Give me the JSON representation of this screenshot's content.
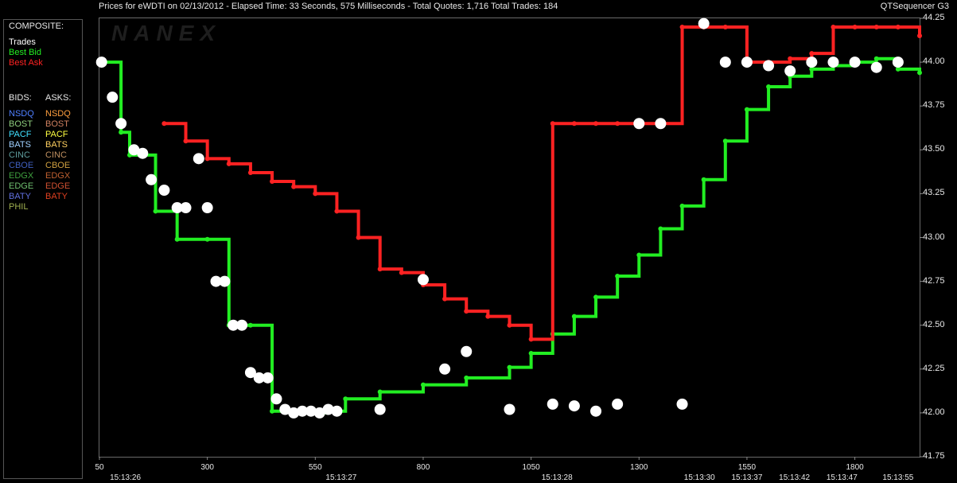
{
  "header": {
    "title": "Prices for  eWDTI  on  02/13/2012  -  Elapsed Time: 33 Seconds, 575 Milliseconds  -  Total Quotes: 1,716  Total Trades: 184",
    "app": "QTSequencer G3",
    "watermark": "NANEX"
  },
  "legend": {
    "composite_label": "COMPOSITE:",
    "composite": [
      {
        "label": "Trades",
        "color": "#ffffff"
      },
      {
        "label": "Best Bid",
        "color": "#22ee22"
      },
      {
        "label": "Best Ask",
        "color": "#ff2222"
      }
    ],
    "bids_label": "BIDS:",
    "asks_label": "ASKS:",
    "bids": [
      {
        "label": "NSDQ",
        "color": "#4f7fff"
      },
      {
        "label": "BOST",
        "color": "#8fcf7f"
      },
      {
        "label": "PACF",
        "color": "#40e0ff"
      },
      {
        "label": "BATS",
        "color": "#9fd0ff"
      },
      {
        "label": "CINC",
        "color": "#5f9f9f"
      },
      {
        "label": "CBOE",
        "color": "#3f5fbf"
      },
      {
        "label": "EDGX",
        "color": "#3fa03f"
      },
      {
        "label": "EDGE",
        "color": "#6fbf6f"
      },
      {
        "label": "BATY",
        "color": "#6070e0"
      },
      {
        "label": "PHIL",
        "color": "#9faf4f"
      }
    ],
    "asks": [
      {
        "label": "NSDQ",
        "color": "#ff9f3f"
      },
      {
        "label": "BOST",
        "color": "#d08060"
      },
      {
        "label": "PACF",
        "color": "#ffff40"
      },
      {
        "label": "BATS",
        "color": "#ffd060"
      },
      {
        "label": "CINC",
        "color": "#c09060"
      },
      {
        "label": "CBOE",
        "color": "#d0a040"
      },
      {
        "label": "EDGX",
        "color": "#c06030"
      },
      {
        "label": "EDGE",
        "color": "#d05030"
      },
      {
        "label": "BATY",
        "color": "#e04020"
      }
    ]
  },
  "chart_data": {
    "type": "line",
    "ylim": [
      41.75,
      44.25
    ],
    "xlim": [
      50,
      1950
    ],
    "y_ticks": [
      "44.25",
      "44.00",
      "43.75",
      "43.50",
      "43.25",
      "43.00",
      "42.75",
      "42.50",
      "42.25",
      "42.00",
      "41.75"
    ],
    "x_ticks": [
      {
        "x": 50,
        "label": "50"
      },
      {
        "x": 300,
        "label": "300"
      },
      {
        "x": 550,
        "label": "550"
      },
      {
        "x": 800,
        "label": "800"
      },
      {
        "x": 1050,
        "label": "1050"
      },
      {
        "x": 1300,
        "label": "1300"
      },
      {
        "x": 1550,
        "label": "1550"
      },
      {
        "x": 1800,
        "label": "1800"
      }
    ],
    "time_ticks": [
      {
        "x": 110,
        "label": "15:13:26"
      },
      {
        "x": 610,
        "label": "15:13:27"
      },
      {
        "x": 1110,
        "label": "15:13:28"
      },
      {
        "x": 1440,
        "label": "15:13:30"
      },
      {
        "x": 1550,
        "label": "15:13:37"
      },
      {
        "x": 1660,
        "label": "15:13:42"
      },
      {
        "x": 1770,
        "label": "15:13:47"
      },
      {
        "x": 1900,
        "label": "15:13:55"
      }
    ],
    "series": [
      {
        "name": "Best Bid",
        "color": "#22ee22",
        "x": [
          50,
          100,
          120,
          180,
          230,
          300,
          350,
          400,
          450,
          500,
          550,
          580,
          620,
          700,
          800,
          900,
          1000,
          1050,
          1100,
          1150,
          1200,
          1250,
          1300,
          1350,
          1400,
          1450,
          1500,
          1550,
          1600,
          1650,
          1700,
          1750,
          1800,
          1850,
          1900,
          1950
        ],
        "values": [
          44.0,
          43.6,
          43.47,
          43.15,
          42.99,
          42.99,
          42.5,
          42.5,
          42.01,
          42.01,
          42.0,
          42.01,
          42.08,
          42.12,
          42.16,
          42.2,
          42.26,
          42.34,
          42.45,
          42.55,
          42.66,
          42.78,
          42.9,
          43.05,
          43.18,
          43.33,
          43.55,
          43.73,
          43.86,
          43.92,
          43.96,
          43.98,
          44.0,
          44.02,
          43.96,
          43.94
        ]
      },
      {
        "name": "Best Ask",
        "color": "#ff2222",
        "x": [
          200,
          250,
          300,
          350,
          400,
          450,
          500,
          550,
          600,
          650,
          700,
          750,
          800,
          850,
          900,
          950,
          1000,
          1050,
          1100,
          1150,
          1200,
          1250,
          1300,
          1350,
          1400,
          1450,
          1500,
          1550,
          1600,
          1650,
          1700,
          1750,
          1800,
          1850,
          1900,
          1950
        ],
        "values": [
          43.65,
          43.55,
          43.45,
          43.42,
          43.37,
          43.32,
          43.29,
          43.25,
          43.15,
          43.0,
          42.82,
          42.8,
          42.73,
          42.65,
          42.58,
          42.55,
          42.5,
          42.42,
          43.65,
          43.65,
          43.65,
          43.65,
          43.65,
          43.65,
          44.2,
          44.2,
          44.2,
          44.0,
          44.0,
          44.02,
          44.05,
          44.2,
          44.2,
          44.2,
          44.2,
          44.15
        ]
      },
      {
        "name": "Trades",
        "color": "#ffffff",
        "x": [
          55,
          80,
          100,
          130,
          150,
          170,
          200,
          230,
          250,
          280,
          300,
          320,
          340,
          360,
          380,
          400,
          420,
          440,
          460,
          480,
          500,
          520,
          540,
          560,
          580,
          600,
          700,
          800,
          850,
          900,
          1000,
          1100,
          1150,
          1200,
          1250,
          1300,
          1350,
          1400,
          1450,
          1500,
          1550,
          1600,
          1650,
          1700,
          1750,
          1800,
          1850,
          1900
        ],
        "values": [
          44.0,
          43.8,
          43.65,
          43.5,
          43.48,
          43.33,
          43.27,
          43.17,
          43.17,
          43.45,
          43.17,
          42.75,
          42.75,
          42.5,
          42.5,
          42.23,
          42.2,
          42.2,
          42.08,
          42.02,
          42.0,
          42.01,
          42.01,
          42.0,
          42.02,
          42.01,
          42.02,
          42.76,
          42.25,
          42.35,
          42.02,
          42.05,
          42.04,
          42.01,
          42.05,
          43.65,
          43.65,
          42.05,
          44.22,
          44.0,
          44.0,
          43.98,
          43.95,
          44.0,
          44.0,
          44.0,
          43.97,
          44.0
        ]
      }
    ]
  }
}
